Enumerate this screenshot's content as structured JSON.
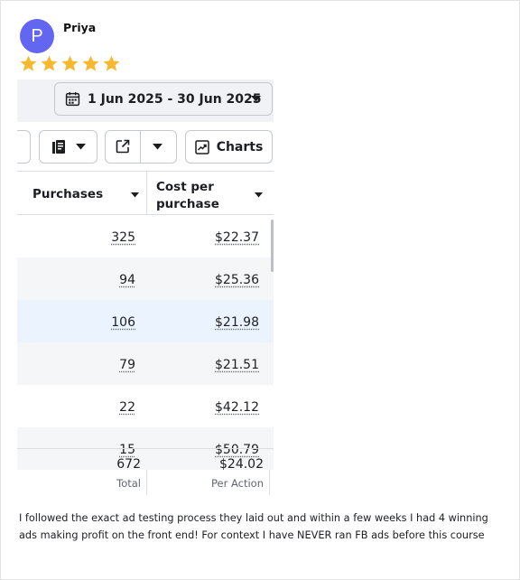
{
  "reviewer": {
    "initial": "P",
    "name": "Priya",
    "rating": 5,
    "avatar_color": "#6366f1",
    "star_color": "#f5b82e"
  },
  "screenshot": {
    "date_range": "1 Jun 2025 - 30 Jun 2025",
    "toolbar": {
      "charts_label": "Charts"
    },
    "columns": {
      "purchases": "Purchases",
      "cost_per_purchase": "Cost per purchase"
    },
    "rows": [
      {
        "purchases": "325",
        "cost": "$22.37",
        "highlight": false
      },
      {
        "purchases": "94",
        "cost": "$25.36",
        "highlight": false
      },
      {
        "purchases": "106",
        "cost": "$21.98",
        "highlight": true
      },
      {
        "purchases": "79",
        "cost": "$21.51",
        "highlight": false
      },
      {
        "purchases": "22",
        "cost": "$42.12",
        "highlight": false
      },
      {
        "purchases": "15",
        "cost": "$50.79",
        "highlight": false
      }
    ],
    "totals": {
      "purchases": "672",
      "purchases_label": "Total",
      "cost": "$24.02",
      "cost_label": "Per Action"
    }
  },
  "review_text": "I followed the exact ad testing process they laid out and within a few weeks I had 4 winning ads making profit on the front end! For context I have NEVER ran FB ads before this course"
}
